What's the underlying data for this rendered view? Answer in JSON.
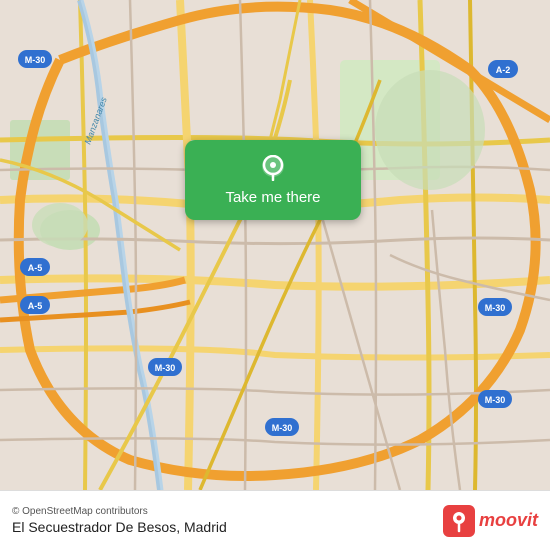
{
  "map": {
    "background_color": "#e8e0d8",
    "center_lat": 40.416,
    "center_lon": -3.703
  },
  "button": {
    "label": "Take me there",
    "icon": "📍"
  },
  "bottom_bar": {
    "osm_credit": "© OpenStreetMap contributors",
    "location_name": "El Secuestrador De Besos, Madrid",
    "moovit_label": "moovit"
  }
}
